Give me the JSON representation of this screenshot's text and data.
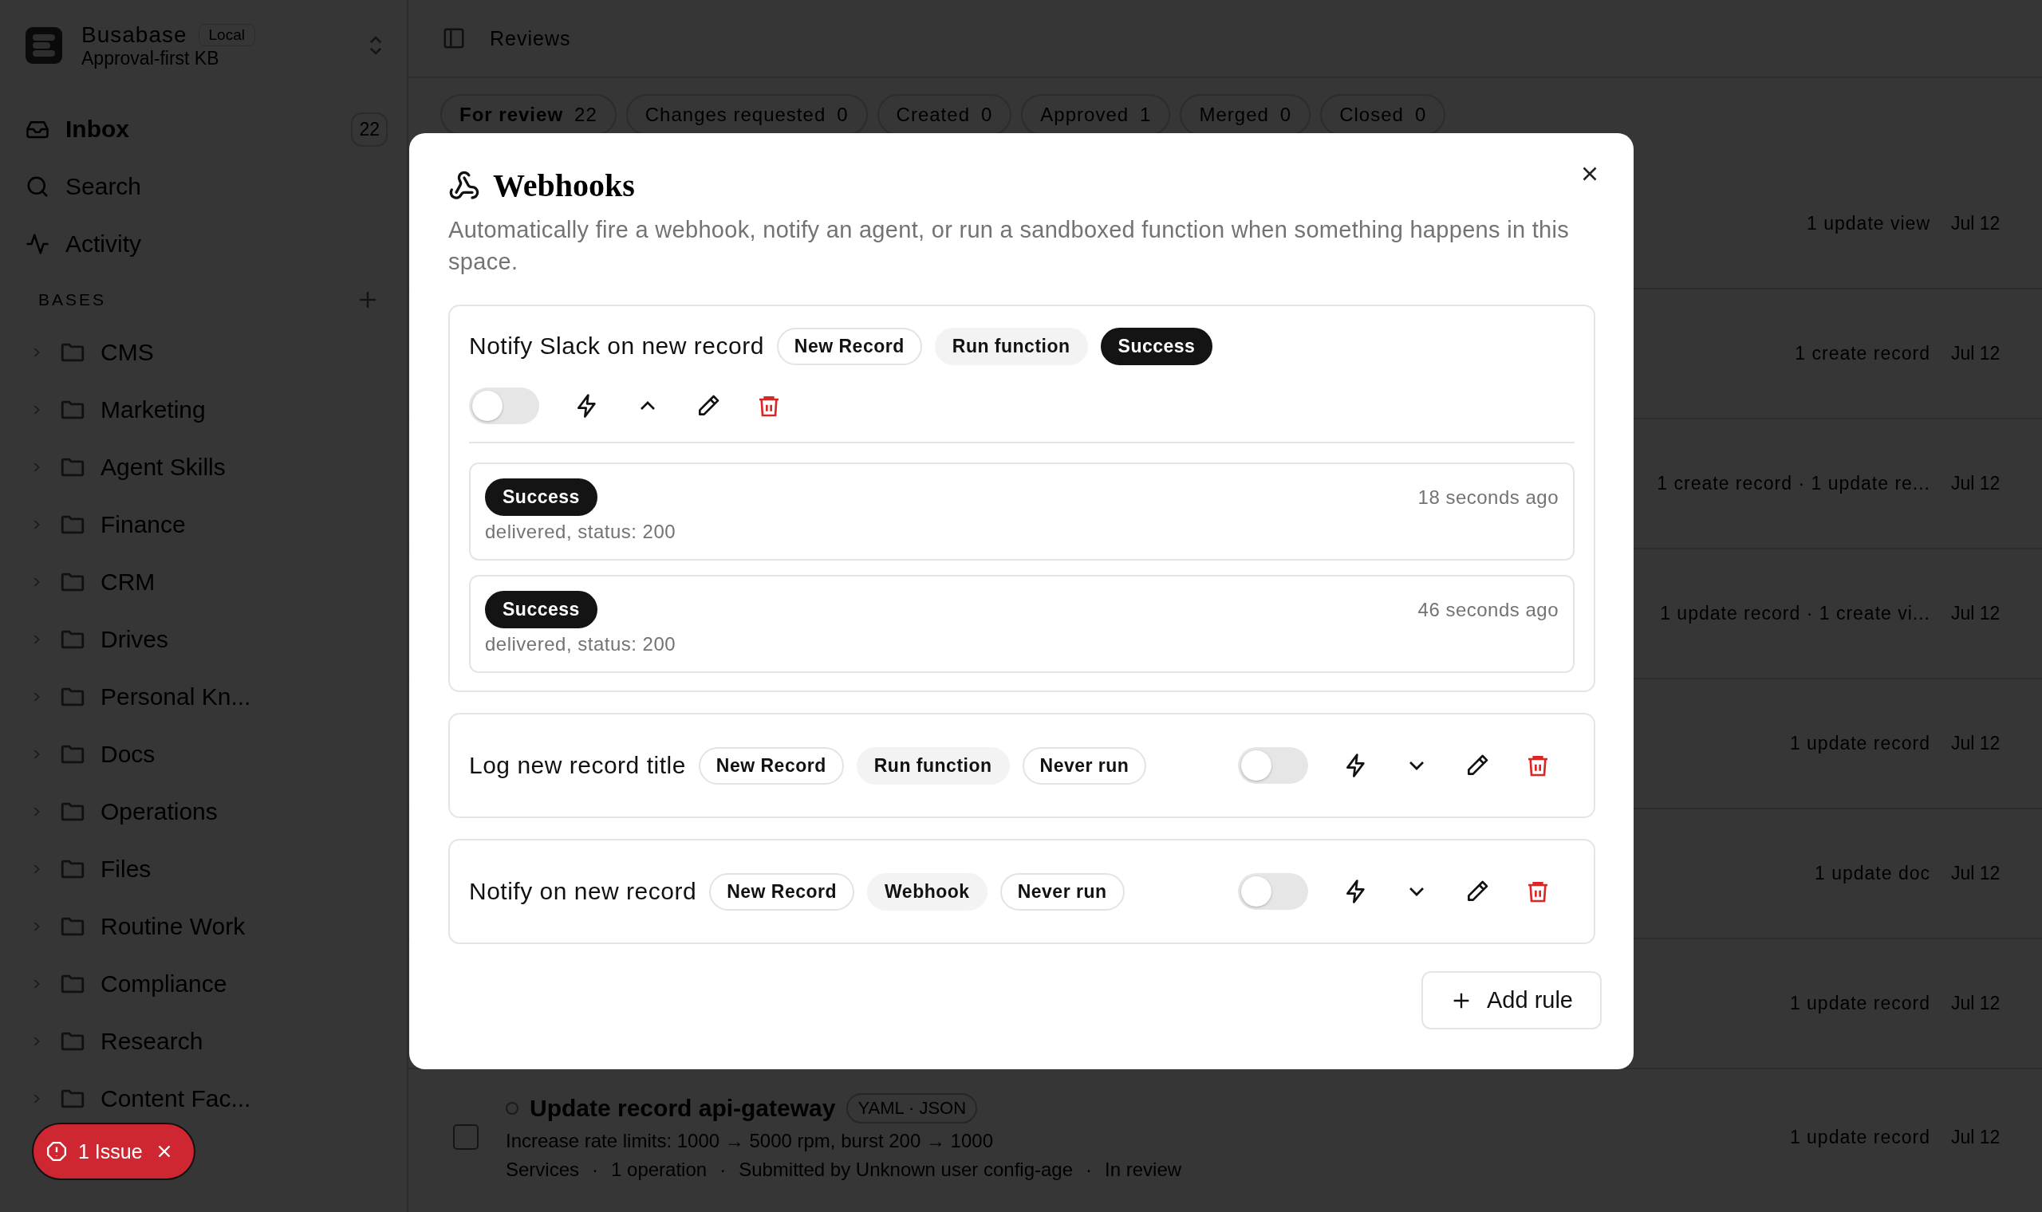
{
  "workspace": {
    "name": "Busabase",
    "badge": "Local",
    "subtitle": "Approval-first KB"
  },
  "nav": [
    {
      "label": "Inbox",
      "count": "22",
      "selected": true
    },
    {
      "label": "Search",
      "selected": false
    },
    {
      "label": "Activity",
      "selected": false
    }
  ],
  "bases": {
    "heading": "BASES",
    "items": [
      {
        "label": "CMS"
      },
      {
        "label": "Marketing"
      },
      {
        "label": "Agent Skills"
      },
      {
        "label": "Finance"
      },
      {
        "label": "CRM"
      },
      {
        "label": "Drives"
      },
      {
        "label": "Personal Kn..."
      },
      {
        "label": "Docs"
      },
      {
        "label": "Operations"
      },
      {
        "label": "Files"
      },
      {
        "label": "Routine Work"
      },
      {
        "label": "Compliance"
      },
      {
        "label": "Research"
      },
      {
        "label": "Content Fac..."
      }
    ]
  },
  "issue_toast": {
    "label": "1 Issue"
  },
  "header": {
    "title": "Reviews"
  },
  "tabs": [
    {
      "label": "For review",
      "count": "22",
      "selected": true
    },
    {
      "label": "Changes requested",
      "count": "0",
      "selected": false
    },
    {
      "label": "Created",
      "count": "0",
      "selected": false
    },
    {
      "label": "Approved",
      "count": "1",
      "selected": false
    },
    {
      "label": "Merged",
      "count": "0",
      "selected": false
    },
    {
      "label": "Closed",
      "count": "0",
      "selected": false
    }
  ],
  "reviews": [
    {
      "summary": "1 update view",
      "date": "Jul 12"
    },
    {
      "summary": "1 create record",
      "date": "Jul 12"
    },
    {
      "summary": "1 create record · 1 update re...",
      "date": "Jul 12"
    },
    {
      "summary": "1 update record · 1 create vi...",
      "date": "Jul 12"
    },
    {
      "summary": "1 update record",
      "date": "Jul 12"
    },
    {
      "summary": "1 update doc",
      "date": "Jul 12"
    },
    {
      "summary": "1 update record",
      "date": "Jul 12"
    }
  ],
  "last_review": {
    "title": "Update record api-gateway",
    "badge": "YAML · JSON",
    "description": "Increase rate limits: 1000 → 5000 rpm, burst 200 → 1000",
    "meta": [
      "Services",
      "1 operation",
      "Submitted by Unknown user config-age",
      "In review"
    ],
    "separator": "·",
    "summary": "1 update record",
    "date": "Jul 12",
    "checked": false
  },
  "modal": {
    "title": "Webhooks",
    "description": "Automatically fire a webhook, notify an agent, or run a sandboxed function when something happens in this space.",
    "rules": [
      {
        "name": "Notify Slack on new record",
        "tags": [
          {
            "label": "New Record",
            "kind": "outline"
          },
          {
            "label": "Run function",
            "kind": "muted"
          },
          {
            "label": "Success",
            "kind": "solid"
          }
        ],
        "enabled": false,
        "expanded": true,
        "runs": [
          {
            "status": "Success",
            "time": "18 seconds ago",
            "detail": "delivered, status: 200"
          },
          {
            "status": "Success",
            "time": "46 seconds ago",
            "detail": "delivered, status: 200"
          }
        ]
      },
      {
        "name": "Log new record title",
        "tags": [
          {
            "label": "New Record",
            "kind": "outline"
          },
          {
            "label": "Run function",
            "kind": "muted"
          },
          {
            "label": "Never run",
            "kind": "outline"
          }
        ],
        "enabled": false,
        "expanded": false
      },
      {
        "name": "Notify on new record",
        "tags": [
          {
            "label": "New Record",
            "kind": "outline"
          },
          {
            "label": "Webhook",
            "kind": "muted"
          },
          {
            "label": "Never run",
            "kind": "outline"
          }
        ],
        "enabled": false,
        "expanded": false
      }
    ],
    "add_button": "Add rule"
  }
}
